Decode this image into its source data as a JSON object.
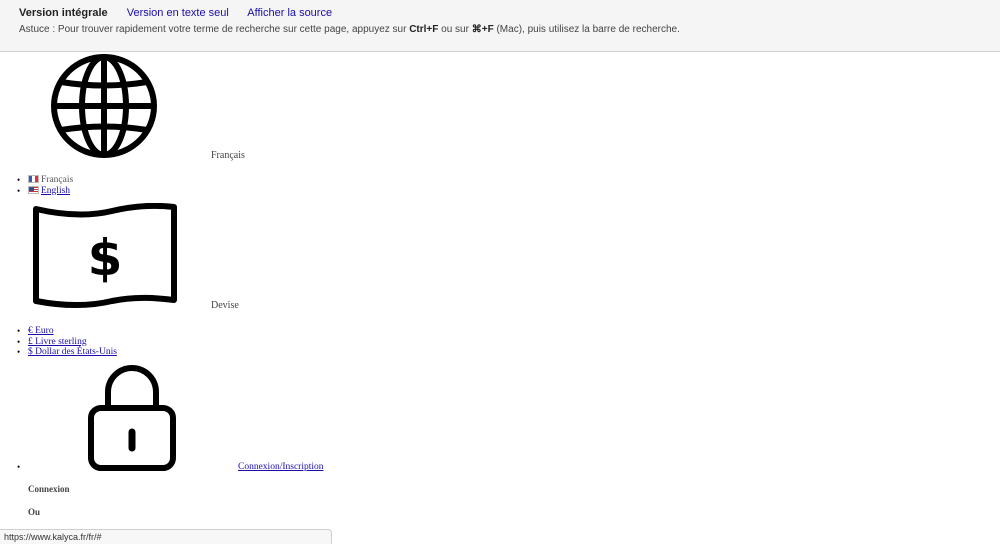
{
  "cache_bar": {
    "tabs": [
      {
        "label": "Version intégrale",
        "active": true
      },
      {
        "label": "Version en texte seul",
        "active": false
      },
      {
        "label": "Afficher la source",
        "active": false
      }
    ],
    "tip": {
      "prefix": "Astuce : Pour trouver rapidement votre terme de recherche sur cette page, appuyez sur ",
      "key1": "Ctrl+F",
      "middle": " ou sur ",
      "key2": "⌘+F",
      "suffix": " (Mac), puis utilisez la barre de recherche."
    }
  },
  "language": {
    "icon": "globe-icon",
    "label": "Français",
    "options": [
      {
        "label": "Français",
        "flag": "fr",
        "is_link": false
      },
      {
        "label": "English",
        "flag": "us",
        "is_link": true
      }
    ]
  },
  "currency": {
    "icon": "dollar-banknote-icon",
    "label": "Devise",
    "options": [
      {
        "label": "€ Euro"
      },
      {
        "label": "£ Livre sterling"
      },
      {
        "label": "$ Dollar des États-Unis"
      }
    ]
  },
  "account": {
    "icon": "padlock-icon",
    "link_label": "Connexion/Inscription",
    "login_heading": "Connexion",
    "or_heading": "Ou"
  },
  "status_bar": {
    "url": "https://www.kalyca.fr/fr/#"
  },
  "colors": {
    "link": "#1a0dab",
    "cache_bar_bg": "#f5f5f5"
  }
}
